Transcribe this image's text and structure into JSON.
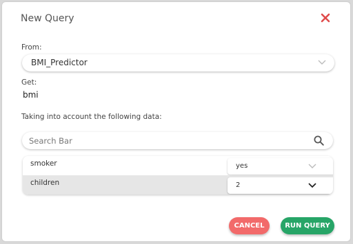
{
  "dialog": {
    "title": "New Query",
    "from_label": "From:",
    "from_value": "BMI_Predictor",
    "get_label": "Get:",
    "get_value": "bmi",
    "data_label": "Taking into account the following data:",
    "search_placeholder": "Search Bar",
    "rows": [
      {
        "name": "smoker",
        "value": "yes"
      },
      {
        "name": "children",
        "value": "2"
      }
    ],
    "cancel_label": "CANCEL",
    "run_label": "RUN QUERY"
  },
  "colors": {
    "close": "#e04b4b",
    "cancel": "#f26a6a",
    "run": "#27a567"
  },
  "icons": [
    "close-icon",
    "chevron-down-icon",
    "search-icon"
  ]
}
